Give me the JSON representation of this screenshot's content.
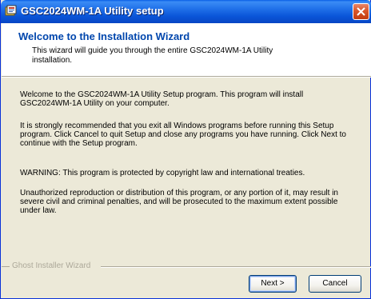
{
  "window": {
    "title": "GSC2024WM-1A Utility setup"
  },
  "header": {
    "title": "Welcome to the Installation Wizard",
    "subtitle": "This wizard will guide you through the entire GSC2024WM-1A Utility installation."
  },
  "body": {
    "paragraphs": [
      "Welcome to the GSC2024WM-1A Utility Setup program. This program will install GSC2024WM-1A Utility on your computer.",
      "It is strongly recommended that you exit all Windows programs before running this Setup program. Click Cancel to quit Setup and close any programs you have running. Click Next to continue with the Setup program.",
      "WARNING: This program is protected by copyright law and international treaties.",
      "Unauthorized reproduction or distribution of this program, or any portion of it, may result in severe civil and criminal penalties, and will be prosecuted to the maximum extent possible under law."
    ]
  },
  "footer": {
    "brand": "Ghost Installer Wizard",
    "next_label": "Next >",
    "cancel_label": "Cancel"
  },
  "icons": {
    "app": "installer-icon",
    "close": "close-icon"
  },
  "colors": {
    "title_bar": "#0a55d8",
    "header_title": "#0046ad",
    "dialog_bg": "#ece9d8",
    "close_button": "#d9562a"
  }
}
